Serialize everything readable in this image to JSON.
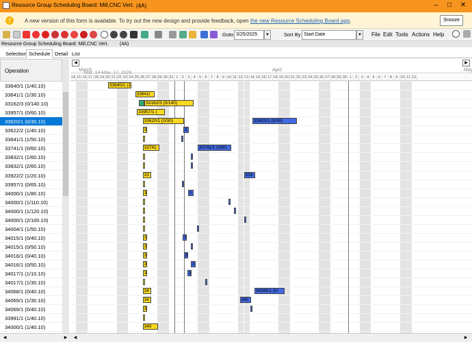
{
  "window": {
    "title": "Resource Group Scheduling Board: Mill,CNC Vert.",
    "tag": "(4A)"
  },
  "notice": {
    "text": "A new version of this form is available. To try out the new design and provide feedback, open",
    "link": "the new Resource Scheduling Board app",
    "end": ".",
    "snooze": "Snooze"
  },
  "toolbar": {
    "goto_label": "Goto",
    "goto_value": "3/25/2025",
    "sort_label": "Sort By",
    "sort_value": "Start Date",
    "menus": [
      "File",
      "Edit",
      "Tools",
      "Actions",
      "Help"
    ]
  },
  "crumb": {
    "title": "Resource Group Scheduling Board: Mill,CNC Vert.",
    "tag": "(4A)"
  },
  "tabs": [
    "Selection",
    "Schedule",
    "Detail",
    "List"
  ],
  "active_tab": 1,
  "list": {
    "header": "Operation",
    "selected": 5,
    "rows": [
      "33640/1 (1/40.10)",
      "33641/1 (1/30.10)",
      "33162/3 (0/140.10)",
      "33957/1 (0/60.10)",
      "33620/1 (0/30.10)",
      "33622/2 (1/40.10)",
      "33641/1 (1/50.10)",
      "33741/1 (0/60.10)",
      "33832/1 (1/60.10)",
      "33832/1 (2/60.10)",
      "33922/2 (1/20.10)",
      "33957/1 (0/65.10)",
      "34000/1 (1/80.10)",
      "34000/1 (1/110.10)",
      "34000/1 (1/120.10)",
      "34000/1 (2/100.10)",
      "34004/1 (1/50.10)",
      "34015/1 (0/40.10)",
      "34015/1 (0/50.10)",
      "34016/1 (0/40.10)",
      "34016/1 (0/50.10)",
      "34017/1 (1/10.10)",
      "34017/1 (1/30.10)",
      "34068/1 (0/40.10)",
      "34069/1 (1/30.10)",
      "34069/1 (0/40.10)",
      "33991/1 (1/40.10)",
      "34000/1 (1/40.10)"
    ]
  },
  "timeline": {
    "months": [
      "March",
      "April",
      "May"
    ],
    "range": "Mar. 14-May. 17, 2025",
    "days": [
      "14",
      "15",
      "16",
      "17",
      "18",
      "19",
      "20",
      "21",
      "22",
      "23",
      "24",
      "25",
      "26",
      "27",
      "28",
      "29",
      "30",
      "31",
      "1",
      "2",
      "3",
      "4",
      "5",
      "6",
      "7",
      "8",
      "9",
      "10",
      "11",
      "12",
      "13",
      "14",
      "15",
      "16",
      "17",
      "18",
      "19",
      "20",
      "21",
      "22",
      "23",
      "24",
      "25",
      "26",
      "27",
      "28",
      "29",
      "30",
      "1",
      "2",
      "3",
      "4",
      "5",
      "6",
      "7",
      "8",
      "9",
      "10",
      "11",
      "12"
    ]
  },
  "bars": [
    {
      "row": 0,
      "day": 6.5,
      "len": 4,
      "color": "y",
      "label": "33640/1 (1/40"
    },
    {
      "row": 1,
      "day": 11.2,
      "len": 3.3,
      "color": "y",
      "label": "33641/"
    },
    {
      "row": 2,
      "day": 11.8,
      "len": 1,
      "color": "g",
      "label": ""
    },
    {
      "row": 2,
      "day": 12.8,
      "len": 8.5,
      "color": "y",
      "label": "33162/3 (0/140)"
    },
    {
      "row": 3,
      "day": 11.5,
      "len": 4.8,
      "color": "y",
      "label": "33957/1 ("
    },
    {
      "row": 4,
      "day": 12.5,
      "len": 7.2,
      "color": "y",
      "label": "33620/1 (0/30)"
    },
    {
      "row": 4,
      "day": 31.5,
      "len": 7.7,
      "color": "b",
      "label": "33620/1 (0/30)"
    },
    {
      "row": 5,
      "day": 12.5,
      "len": 0.8,
      "color": "y",
      "label": "3"
    },
    {
      "row": 5,
      "day": 19.5,
      "len": 1,
      "color": "b",
      "label": "3"
    },
    {
      "row": 6,
      "day": 12.5,
      "len": 0.3,
      "color": "y",
      "label": ""
    },
    {
      "row": 6,
      "day": 19.2,
      "len": 0.3,
      "color": "b",
      "label": ""
    },
    {
      "row": 7,
      "day": 12.5,
      "len": 2.9,
      "color": "y",
      "label": "33741"
    },
    {
      "row": 7,
      "day": 22,
      "len": 5.8,
      "color": "b",
      "label": "33741/1 (0/60"
    },
    {
      "row": 8,
      "day": 12.5,
      "len": 0.3,
      "color": "y",
      "label": ""
    },
    {
      "row": 8,
      "day": 20.8,
      "len": 0.3,
      "color": "b",
      "label": ""
    },
    {
      "row": 9,
      "day": 12.5,
      "len": 0.3,
      "color": "y",
      "label": ""
    },
    {
      "row": 9,
      "day": 20.8,
      "len": 0.3,
      "color": "b",
      "label": ""
    },
    {
      "row": 10,
      "day": 12.5,
      "len": 1.5,
      "color": "y",
      "label": "33"
    },
    {
      "row": 10,
      "day": 30,
      "len": 2,
      "color": "b",
      "label": "339"
    },
    {
      "row": 11,
      "day": 12.5,
      "len": 0.3,
      "color": "y",
      "label": ""
    },
    {
      "row": 11,
      "day": 19.3,
      "len": 0.3,
      "color": "b",
      "label": ""
    },
    {
      "row": 12,
      "day": 12.5,
      "len": 0.7,
      "color": "y",
      "label": "3"
    },
    {
      "row": 12,
      "day": 20.3,
      "len": 1,
      "color": "b",
      "label": "3"
    },
    {
      "row": 13,
      "day": 12.5,
      "len": 0.3,
      "color": "y",
      "label": ""
    },
    {
      "row": 13,
      "day": 27.3,
      "len": 0.3,
      "color": "b",
      "label": ""
    },
    {
      "row": 14,
      "day": 12.5,
      "len": 0.3,
      "color": "y",
      "label": ""
    },
    {
      "row": 14,
      "day": 28.3,
      "len": 0.3,
      "color": "b",
      "label": ""
    },
    {
      "row": 15,
      "day": 12.5,
      "len": 0.3,
      "color": "y",
      "label": ""
    },
    {
      "row": 15,
      "day": 30.1,
      "len": 0.3,
      "color": "b",
      "label": ""
    },
    {
      "row": 16,
      "day": 12.5,
      "len": 0.3,
      "color": "y",
      "label": ""
    },
    {
      "row": 16,
      "day": 21.9,
      "len": 0.3,
      "color": "b",
      "label": ""
    },
    {
      "row": 17,
      "day": 12.5,
      "len": 0.7,
      "color": "y",
      "label": "3"
    },
    {
      "row": 17,
      "day": 19.4,
      "len": 0.7,
      "color": "b",
      "label": "3"
    },
    {
      "row": 18,
      "day": 12.5,
      "len": 0.7,
      "color": "y",
      "label": "3"
    },
    {
      "row": 18,
      "day": 20.8,
      "len": 0.4,
      "color": "b",
      "label": ""
    },
    {
      "row": 19,
      "day": 12.5,
      "len": 0.7,
      "color": "y",
      "label": "3"
    },
    {
      "row": 19,
      "day": 19.6,
      "len": 0.8,
      "color": "b",
      "label": "3"
    },
    {
      "row": 20,
      "day": 12.5,
      "len": 0.7,
      "color": "y",
      "label": "3"
    },
    {
      "row": 20,
      "day": 20.8,
      "len": 0.8,
      "color": "b",
      "label": "3"
    },
    {
      "row": 21,
      "day": 12.5,
      "len": 0.7,
      "color": "y",
      "label": "3"
    },
    {
      "row": 21,
      "day": 20.2,
      "len": 0.7,
      "color": "b",
      "label": "3"
    },
    {
      "row": 22,
      "day": 12.5,
      "len": 0.3,
      "color": "y",
      "label": ""
    },
    {
      "row": 22,
      "day": 23.3,
      "len": 0.3,
      "color": "b",
      "label": ""
    },
    {
      "row": 23,
      "day": 12.5,
      "len": 1.5,
      "color": "y",
      "label": "34"
    },
    {
      "row": 23,
      "day": 31.8,
      "len": 5.3,
      "color": "b",
      "label": "34068/1 (0/"
    },
    {
      "row": 24,
      "day": 12.5,
      "len": 1.5,
      "color": "y",
      "label": "34"
    },
    {
      "row": 24,
      "day": 29.3,
      "len": 2,
      "color": "b",
      "label": "340"
    },
    {
      "row": 25,
      "day": 12.5,
      "len": 0.7,
      "color": "y",
      "label": "3"
    },
    {
      "row": 25,
      "day": 31.1,
      "len": 0.4,
      "color": "b",
      "label": ""
    },
    {
      "row": 26,
      "day": 12.5,
      "len": 0.3,
      "color": "y",
      "label": ""
    },
    {
      "row": 27,
      "day": 12.5,
      "len": 2.6,
      "color": "y",
      "label": "340"
    }
  ],
  "colors": {
    "titlebar": "#f7941d",
    "selection": "#0078d7",
    "bar_yellow": "#f8d820",
    "bar_blue": "#4169e1"
  }
}
